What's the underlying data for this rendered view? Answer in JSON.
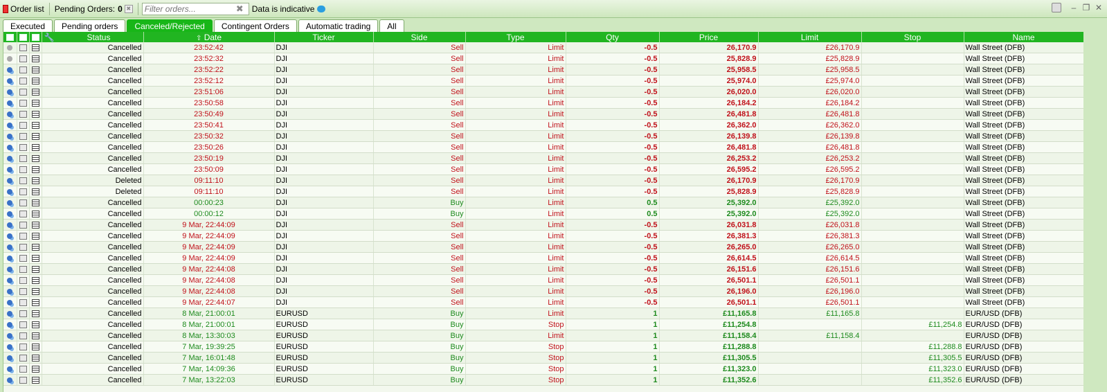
{
  "toolbar": {
    "order_list_label": "Order list",
    "pending_label": "Pending Orders:",
    "pending_count": "0",
    "filter_placeholder": "Filter orders...",
    "indicative_label": "Data is indicative"
  },
  "tabs": [
    {
      "label": "Executed",
      "active": false
    },
    {
      "label": "Pending orders",
      "active": false
    },
    {
      "label": "Canceled/Rejected",
      "active": true
    },
    {
      "label": "Contingent Orders",
      "active": false
    },
    {
      "label": "Automatic trading",
      "active": false
    },
    {
      "label": "All",
      "active": false
    }
  ],
  "columns": [
    "Status",
    "Date",
    "Ticker",
    "Side",
    "Type",
    "Qty",
    "Price",
    "Limit",
    "Stop",
    "Name"
  ],
  "sort_indicator": "⇧",
  "colors": {
    "header_green": "#21b521",
    "sell_red": "#c0111a",
    "buy_green": "#1d8a1d"
  },
  "rows": [
    {
      "status": "Cancelled",
      "date": "23:52:42",
      "ticker": "DJI",
      "side": "Sell",
      "type": "Limit",
      "qty": "-0.5",
      "price": "26,170.9",
      "limit": "£26,170.9",
      "stop": "",
      "name": "Wall Street (DFB)",
      "gear_disabled": true
    },
    {
      "status": "Cancelled",
      "date": "23:52:32",
      "ticker": "DJI",
      "side": "Sell",
      "type": "Limit",
      "qty": "-0.5",
      "price": "25,828.9",
      "limit": "£25,828.9",
      "stop": "",
      "name": "Wall Street (DFB)",
      "gear_disabled": true
    },
    {
      "status": "Cancelled",
      "date": "23:52:22",
      "ticker": "DJI",
      "side": "Sell",
      "type": "Limit",
      "qty": "-0.5",
      "price": "25,958.5",
      "limit": "£25,958.5",
      "stop": "",
      "name": "Wall Street (DFB)"
    },
    {
      "status": "Cancelled",
      "date": "23:52:12",
      "ticker": "DJI",
      "side": "Sell",
      "type": "Limit",
      "qty": "-0.5",
      "price": "25,974.0",
      "limit": "£25,974.0",
      "stop": "",
      "name": "Wall Street (DFB)"
    },
    {
      "status": "Cancelled",
      "date": "23:51:06",
      "ticker": "DJI",
      "side": "Sell",
      "type": "Limit",
      "qty": "-0.5",
      "price": "26,020.0",
      "limit": "£26,020.0",
      "stop": "",
      "name": "Wall Street (DFB)"
    },
    {
      "status": "Cancelled",
      "date": "23:50:58",
      "ticker": "DJI",
      "side": "Sell",
      "type": "Limit",
      "qty": "-0.5",
      "price": "26,184.2",
      "limit": "£26,184.2",
      "stop": "",
      "name": "Wall Street (DFB)"
    },
    {
      "status": "Cancelled",
      "date": "23:50:49",
      "ticker": "DJI",
      "side": "Sell",
      "type": "Limit",
      "qty": "-0.5",
      "price": "26,481.8",
      "limit": "£26,481.8",
      "stop": "",
      "name": "Wall Street (DFB)"
    },
    {
      "status": "Cancelled",
      "date": "23:50:41",
      "ticker": "DJI",
      "side": "Sell",
      "type": "Limit",
      "qty": "-0.5",
      "price": "26,362.0",
      "limit": "£26,362.0",
      "stop": "",
      "name": "Wall Street (DFB)"
    },
    {
      "status": "Cancelled",
      "date": "23:50:32",
      "ticker": "DJI",
      "side": "Sell",
      "type": "Limit",
      "qty": "-0.5",
      "price": "26,139.8",
      "limit": "£26,139.8",
      "stop": "",
      "name": "Wall Street (DFB)"
    },
    {
      "status": "Cancelled",
      "date": "23:50:26",
      "ticker": "DJI",
      "side": "Sell",
      "type": "Limit",
      "qty": "-0.5",
      "price": "26,481.8",
      "limit": "£26,481.8",
      "stop": "",
      "name": "Wall Street (DFB)"
    },
    {
      "status": "Cancelled",
      "date": "23:50:19",
      "ticker": "DJI",
      "side": "Sell",
      "type": "Limit",
      "qty": "-0.5",
      "price": "26,253.2",
      "limit": "£26,253.2",
      "stop": "",
      "name": "Wall Street (DFB)"
    },
    {
      "status": "Cancelled",
      "date": "23:50:09",
      "ticker": "DJI",
      "side": "Sell",
      "type": "Limit",
      "qty": "-0.5",
      "price": "26,595.2",
      "limit": "£26,595.2",
      "stop": "",
      "name": "Wall Street (DFB)"
    },
    {
      "status": "Deleted",
      "date": "09:11:10",
      "ticker": "DJI",
      "side": "Sell",
      "type": "Limit",
      "qty": "-0.5",
      "price": "26,170.9",
      "limit": "£26,170.9",
      "stop": "",
      "name": "Wall Street (DFB)"
    },
    {
      "status": "Deleted",
      "date": "09:11:10",
      "ticker": "DJI",
      "side": "Sell",
      "type": "Limit",
      "qty": "-0.5",
      "price": "25,828.9",
      "limit": "£25,828.9",
      "stop": "",
      "name": "Wall Street (DFB)"
    },
    {
      "status": "Cancelled",
      "date": "00:00:23",
      "ticker": "DJI",
      "side": "Buy",
      "type": "Limit",
      "qty": "0.5",
      "price": "25,392.0",
      "limit": "£25,392.0",
      "stop": "",
      "name": "Wall Street (DFB)"
    },
    {
      "status": "Cancelled",
      "date": "00:00:12",
      "ticker": "DJI",
      "side": "Buy",
      "type": "Limit",
      "qty": "0.5",
      "price": "25,392.0",
      "limit": "£25,392.0",
      "stop": "",
      "name": "Wall Street (DFB)"
    },
    {
      "status": "Cancelled",
      "date": "9 Mar, 22:44:09",
      "ticker": "DJI",
      "side": "Sell",
      "type": "Limit",
      "qty": "-0.5",
      "price": "26,031.8",
      "limit": "£26,031.8",
      "stop": "",
      "name": "Wall Street (DFB)"
    },
    {
      "status": "Cancelled",
      "date": "9 Mar, 22:44:09",
      "ticker": "DJI",
      "side": "Sell",
      "type": "Limit",
      "qty": "-0.5",
      "price": "26,381.3",
      "limit": "£26,381.3",
      "stop": "",
      "name": "Wall Street (DFB)"
    },
    {
      "status": "Cancelled",
      "date": "9 Mar, 22:44:09",
      "ticker": "DJI",
      "side": "Sell",
      "type": "Limit",
      "qty": "-0.5",
      "price": "26,265.0",
      "limit": "£26,265.0",
      "stop": "",
      "name": "Wall Street (DFB)"
    },
    {
      "status": "Cancelled",
      "date": "9 Mar, 22:44:09",
      "ticker": "DJI",
      "side": "Sell",
      "type": "Limit",
      "qty": "-0.5",
      "price": "26,614.5",
      "limit": "£26,614.5",
      "stop": "",
      "name": "Wall Street (DFB)"
    },
    {
      "status": "Cancelled",
      "date": "9 Mar, 22:44:08",
      "ticker": "DJI",
      "side": "Sell",
      "type": "Limit",
      "qty": "-0.5",
      "price": "26,151.6",
      "limit": "£26,151.6",
      "stop": "",
      "name": "Wall Street (DFB)"
    },
    {
      "status": "Cancelled",
      "date": "9 Mar, 22:44:08",
      "ticker": "DJI",
      "side": "Sell",
      "type": "Limit",
      "qty": "-0.5",
      "price": "26,501.1",
      "limit": "£26,501.1",
      "stop": "",
      "name": "Wall Street (DFB)"
    },
    {
      "status": "Cancelled",
      "date": "9 Mar, 22:44:08",
      "ticker": "DJI",
      "side": "Sell",
      "type": "Limit",
      "qty": "-0.5",
      "price": "26,196.0",
      "limit": "£26,196.0",
      "stop": "",
      "name": "Wall Street (DFB)"
    },
    {
      "status": "Cancelled",
      "date": "9 Mar, 22:44:07",
      "ticker": "DJI",
      "side": "Sell",
      "type": "Limit",
      "qty": "-0.5",
      "price": "26,501.1",
      "limit": "£26,501.1",
      "stop": "",
      "name": "Wall Street (DFB)"
    },
    {
      "status": "Cancelled",
      "date": "8 Mar, 21:00:01",
      "ticker": "EURUSD",
      "side": "Buy",
      "type": "Limit",
      "qty": "1",
      "price": "£11,165.8",
      "limit": "£11,165.8",
      "stop": "",
      "name": "EUR/USD (DFB)"
    },
    {
      "status": "Cancelled",
      "date": "8 Mar, 21:00:01",
      "ticker": "EURUSD",
      "side": "Buy",
      "type": "Stop",
      "qty": "1",
      "price": "£11,254.8",
      "limit": "",
      "stop": "£11,254.8",
      "name": "EUR/USD (DFB)"
    },
    {
      "status": "Cancelled",
      "date": "8 Mar, 13:30:03",
      "ticker": "EURUSD",
      "side": "Buy",
      "type": "Limit",
      "qty": "1",
      "price": "£11,158.4",
      "limit": "£11,158.4",
      "stop": "",
      "name": "EUR/USD (DFB)"
    },
    {
      "status": "Cancelled",
      "date": "7 Mar, 19:39:25",
      "ticker": "EURUSD",
      "side": "Buy",
      "type": "Stop",
      "qty": "1",
      "price": "£11,288.8",
      "limit": "",
      "stop": "£11,288.8",
      "name": "EUR/USD (DFB)"
    },
    {
      "status": "Cancelled",
      "date": "7 Mar, 16:01:48",
      "ticker": "EURUSD",
      "side": "Buy",
      "type": "Stop",
      "qty": "1",
      "price": "£11,305.5",
      "limit": "",
      "stop": "£11,305.5",
      "name": "EUR/USD (DFB)"
    },
    {
      "status": "Cancelled",
      "date": "7 Mar, 14:09:36",
      "ticker": "EURUSD",
      "side": "Buy",
      "type": "Stop",
      "qty": "1",
      "price": "£11,323.0",
      "limit": "",
      "stop": "£11,323.0",
      "name": "EUR/USD (DFB)"
    },
    {
      "status": "Cancelled",
      "date": "7 Mar, 13:22:03",
      "ticker": "EURUSD",
      "side": "Buy",
      "type": "Stop",
      "qty": "1",
      "price": "£11,352.6",
      "limit": "",
      "stop": "£11,352.6",
      "name": "EUR/USD (DFB)"
    }
  ]
}
